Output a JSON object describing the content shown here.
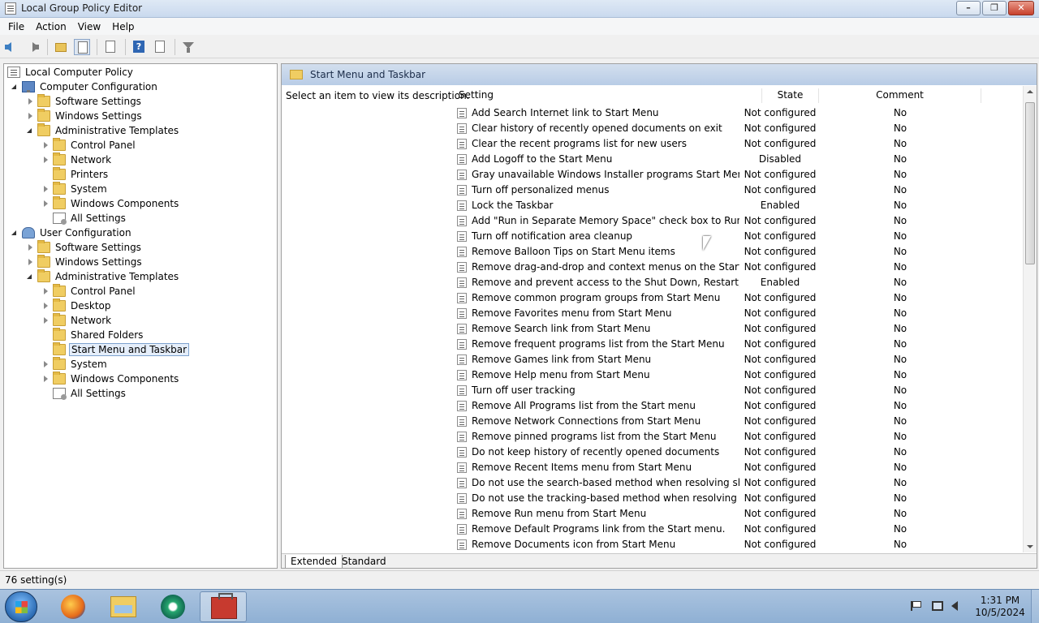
{
  "window": {
    "title": "Local Group Policy Editor"
  },
  "menubar": {
    "items": [
      "File",
      "Action",
      "View",
      "Help"
    ]
  },
  "toolbar": {
    "icons": [
      "back-arrow-icon",
      "forward-arrow-icon",
      "up-folder-icon",
      "show-hide-tree-icon",
      "export-list-icon",
      "help-icon",
      "properties-icon",
      "filter-icon"
    ]
  },
  "tree": {
    "root": "Local Computer Policy",
    "items": [
      {
        "label": "Computer Configuration"
      },
      {
        "label": "Software Settings"
      },
      {
        "label": "Windows Settings"
      },
      {
        "label": "Administrative Templates"
      },
      {
        "label": "Control Panel"
      },
      {
        "label": "Network"
      },
      {
        "label": "Printers"
      },
      {
        "label": "System"
      },
      {
        "label": "Windows Components"
      },
      {
        "label": "All Settings"
      },
      {
        "label": "User Configuration"
      },
      {
        "label": "Software Settings"
      },
      {
        "label": "Windows Settings"
      },
      {
        "label": "Administrative Templates"
      },
      {
        "label": "Control Panel"
      },
      {
        "label": "Desktop"
      },
      {
        "label": "Network"
      },
      {
        "label": "Shared Folders"
      },
      {
        "label": "Start Menu and Taskbar"
      },
      {
        "label": "System"
      },
      {
        "label": "Windows Components"
      },
      {
        "label": "All Settings"
      }
    ]
  },
  "right": {
    "header_title": "Start Menu and Taskbar",
    "description": "Select an item to view its description.",
    "columns": {
      "setting": "Setting",
      "state": "State",
      "comment": "Comment"
    },
    "rows": [
      {
        "name": "Add Search Internet link to Start Menu",
        "state": "Not configured",
        "comment": "No"
      },
      {
        "name": "Clear history of recently opened documents on exit",
        "state": "Not configured",
        "comment": "No"
      },
      {
        "name": "Clear the recent programs list for new users",
        "state": "Not configured",
        "comment": "No"
      },
      {
        "name": "Add Logoff to the Start Menu",
        "state": "Disabled",
        "comment": "No"
      },
      {
        "name": "Gray unavailable Windows Installer programs Start Menu sh...",
        "state": "Not configured",
        "comment": "No"
      },
      {
        "name": "Turn off personalized menus",
        "state": "Not configured",
        "comment": "No"
      },
      {
        "name": "Lock the Taskbar",
        "state": "Enabled",
        "comment": "No"
      },
      {
        "name": "Add \"Run in Separate Memory Space\" check box to Run dial...",
        "state": "Not configured",
        "comment": "No"
      },
      {
        "name": "Turn off notification area cleanup",
        "state": "Not configured",
        "comment": "No"
      },
      {
        "name": "Remove Balloon Tips on Start Menu items",
        "state": "Not configured",
        "comment": "No"
      },
      {
        "name": "Remove drag-and-drop and context menus on the Start Me...",
        "state": "Not configured",
        "comment": "No"
      },
      {
        "name": "Remove and prevent access to the Shut Down, Restart, Sleep...",
        "state": "Enabled",
        "comment": "No"
      },
      {
        "name": "Remove common program groups from Start Menu",
        "state": "Not configured",
        "comment": "No"
      },
      {
        "name": "Remove Favorites menu from Start Menu",
        "state": "Not configured",
        "comment": "No"
      },
      {
        "name": "Remove Search link from Start Menu",
        "state": "Not configured",
        "comment": "No"
      },
      {
        "name": "Remove frequent programs list from the Start Menu",
        "state": "Not configured",
        "comment": "No"
      },
      {
        "name": "Remove Games link from Start Menu",
        "state": "Not configured",
        "comment": "No"
      },
      {
        "name": "Remove Help menu from Start Menu",
        "state": "Not configured",
        "comment": "No"
      },
      {
        "name": "Turn off user tracking",
        "state": "Not configured",
        "comment": "No"
      },
      {
        "name": "Remove All Programs list from the Start menu",
        "state": "Not configured",
        "comment": "No"
      },
      {
        "name": "Remove Network Connections from Start Menu",
        "state": "Not configured",
        "comment": "No"
      },
      {
        "name": "Remove pinned programs list from the Start Menu",
        "state": "Not configured",
        "comment": "No"
      },
      {
        "name": "Do not keep history of recently opened documents",
        "state": "Not configured",
        "comment": "No"
      },
      {
        "name": "Remove Recent Items menu from Start Menu",
        "state": "Not configured",
        "comment": "No"
      },
      {
        "name": "Do not use the search-based method when resolving shell s...",
        "state": "Not configured",
        "comment": "No"
      },
      {
        "name": "Do not use the tracking-based method when resolving shell ...",
        "state": "Not configured",
        "comment": "No"
      },
      {
        "name": "Remove Run menu from Start Menu",
        "state": "Not configured",
        "comment": "No"
      },
      {
        "name": "Remove Default Programs link from the Start menu.",
        "state": "Not configured",
        "comment": "No"
      },
      {
        "name": "Remove Documents icon from Start Menu",
        "state": "Not configured",
        "comment": "No"
      }
    ],
    "tabs": [
      "Extended",
      "Standard"
    ]
  },
  "status": {
    "text": "76 setting(s)"
  },
  "taskbar": {
    "clock_time": "1:31 PM",
    "clock_date": "10/5/2024"
  }
}
